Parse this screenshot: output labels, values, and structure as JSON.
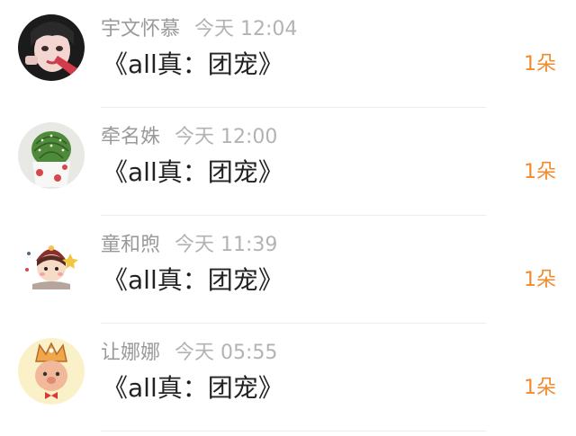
{
  "items": [
    {
      "user": "宇文怀慕",
      "time": "今天 12:04",
      "title": "《all真：团宠》",
      "count": "1朵",
      "avatar_icon": "girl-portrait-icon"
    },
    {
      "user": "牵名姝",
      "time": "今天 12:00",
      "title": "《all真：团宠》",
      "count": "1朵",
      "avatar_icon": "cactus-pot-icon"
    },
    {
      "user": "童和煦",
      "time": "今天 11:39",
      "title": "《all真：团宠》",
      "count": "1朵",
      "avatar_icon": "cartoon-girl-icon"
    },
    {
      "user": "让娜娜",
      "time": "今天 05:55",
      "title": "《all真：团宠》",
      "count": "1朵",
      "avatar_icon": "crown-character-icon"
    }
  ],
  "colors": {
    "username": "#9a9a9a",
    "time": "#b3b3b3",
    "title": "#222222",
    "count": "#f08a2c"
  }
}
